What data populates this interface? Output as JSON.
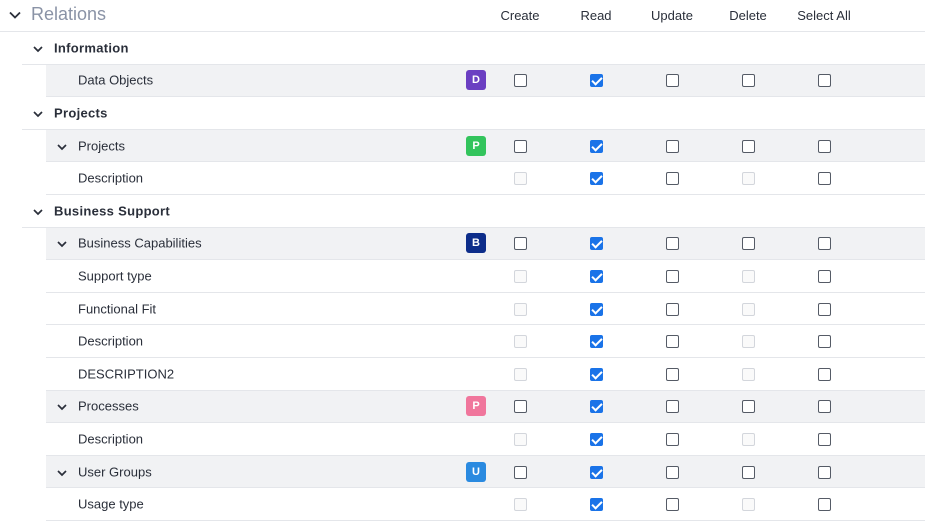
{
  "section": {
    "title": "Relations"
  },
  "columns": [
    "Create",
    "Read",
    "Update",
    "Delete",
    "Select All"
  ],
  "rows": [
    {
      "type": "group",
      "label": "Information"
    },
    {
      "type": "item",
      "label": "Data Objects",
      "badge": "D",
      "badge_color": "#6b3fc2",
      "chevron": false,
      "checks": [
        "unchecked",
        "checked",
        "unchecked",
        "unchecked",
        "unchecked"
      ]
    },
    {
      "type": "group",
      "label": "Projects"
    },
    {
      "type": "item",
      "label": "Projects",
      "badge": "P",
      "badge_color": "#33c45c",
      "chevron": true,
      "checks": [
        "unchecked",
        "checked",
        "unchecked",
        "unchecked",
        "unchecked"
      ]
    },
    {
      "type": "field",
      "label": "Description",
      "checks": [
        "disabled",
        "checked",
        "unchecked",
        "disabled",
        "unchecked"
      ]
    },
    {
      "type": "group",
      "label": "Business Support"
    },
    {
      "type": "item",
      "label": "Business Capabilities",
      "badge": "B",
      "badge_color": "#0d2d8a",
      "chevron": true,
      "checks": [
        "unchecked",
        "checked",
        "unchecked",
        "unchecked",
        "unchecked"
      ]
    },
    {
      "type": "field",
      "label": "Support type",
      "checks": [
        "disabled",
        "checked",
        "unchecked",
        "disabled",
        "unchecked"
      ]
    },
    {
      "type": "field",
      "label": "Functional Fit",
      "checks": [
        "disabled",
        "checked",
        "unchecked",
        "disabled",
        "unchecked"
      ]
    },
    {
      "type": "field",
      "label": "Description",
      "checks": [
        "disabled",
        "checked",
        "unchecked",
        "disabled",
        "unchecked"
      ]
    },
    {
      "type": "field",
      "label": "DESCRIPTION2",
      "checks": [
        "disabled",
        "checked",
        "unchecked",
        "disabled",
        "unchecked"
      ]
    },
    {
      "type": "item",
      "label": "Processes",
      "badge": "P",
      "badge_color": "#f0769c",
      "chevron": true,
      "checks": [
        "unchecked",
        "checked",
        "unchecked",
        "unchecked",
        "unchecked"
      ]
    },
    {
      "type": "field",
      "label": "Description",
      "checks": [
        "disabled",
        "checked",
        "unchecked",
        "disabled",
        "unchecked"
      ]
    },
    {
      "type": "item",
      "label": "User Groups",
      "badge": "U",
      "badge_color": "#2a8ae0",
      "chevron": true,
      "checks": [
        "unchecked",
        "checked",
        "unchecked",
        "unchecked",
        "unchecked"
      ]
    },
    {
      "type": "field",
      "label": "Usage type",
      "checks": [
        "disabled",
        "checked",
        "unchecked",
        "disabled",
        "unchecked"
      ]
    }
  ]
}
